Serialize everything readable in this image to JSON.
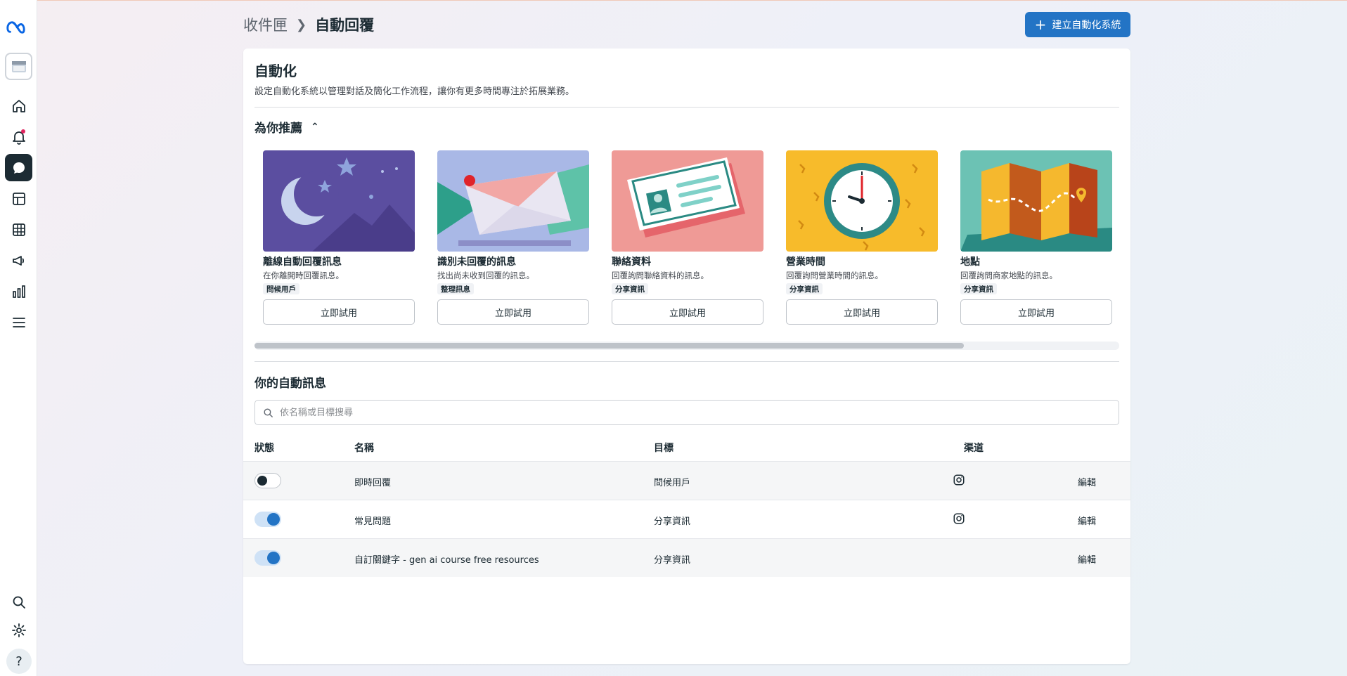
{
  "breadcrumb": {
    "root": "收件匣",
    "current": "自動回覆"
  },
  "create_button": "建立自動化系統",
  "page": {
    "title": "自動化",
    "subtitle": "設定自動化系統以管理對話及簡化工作流程，讓你有更多時間專注於拓展業務。"
  },
  "recommended": {
    "heading": "為你推薦",
    "tiles": [
      {
        "title": "離線自動回覆訊息",
        "desc": "在你離開時回覆訊息。",
        "tag": "問候用戶",
        "button": "立即試用",
        "icon": "moon-night-illustration"
      },
      {
        "title": "識別未回覆的訊息",
        "desc": "找出尚未收到回覆的訊息。",
        "tag": "整理訊息",
        "button": "立即試用",
        "icon": "envelope-illustration"
      },
      {
        "title": "聯絡資料",
        "desc": "回覆詢問聯絡資料的訊息。",
        "tag": "分享資訊",
        "button": "立即試用",
        "icon": "contact-card-illustration"
      },
      {
        "title": "營業時間",
        "desc": "回覆詢問營業時間的訊息。",
        "tag": "分享資訊",
        "button": "立即試用",
        "icon": "clock-illustration"
      },
      {
        "title": "地點",
        "desc": "回覆詢問商家地點的訊息。",
        "tag": "分享資訊",
        "button": "立即試用",
        "icon": "map-illustration"
      }
    ],
    "scroll_progress": 0.82
  },
  "automations": {
    "heading": "你的自動訊息",
    "search_placeholder": "依名稱或目標搜尋",
    "columns": [
      "狀態",
      "名稱",
      "目標",
      "渠道"
    ],
    "rows": [
      {
        "enabled": false,
        "name": "即時回覆",
        "goal": "問候用戶",
        "channel": "instagram-icon",
        "action": "編輯"
      },
      {
        "enabled": true,
        "name": "常見問題",
        "goal": "分享資訊",
        "channel": "instagram-icon",
        "action": "編輯"
      },
      {
        "enabled": true,
        "name": "自訂關鍵字 - gen ai course free resources",
        "goal": "分享資訊",
        "channel": "",
        "action": "編輯"
      }
    ]
  },
  "sidebar": {
    "icons": [
      "meta-logo",
      "page-avatar",
      "home-icon",
      "notifications-icon",
      "inbox-icon",
      "content-icon",
      "planner-icon",
      "ads-icon",
      "insights-icon",
      "menu-icon",
      "search-icon",
      "settings-icon",
      "help-icon"
    ],
    "help_label": "?"
  },
  "colors": {
    "accent": "#2374c5",
    "toggle_on": "#2374c5",
    "text": "#1c2b33"
  }
}
